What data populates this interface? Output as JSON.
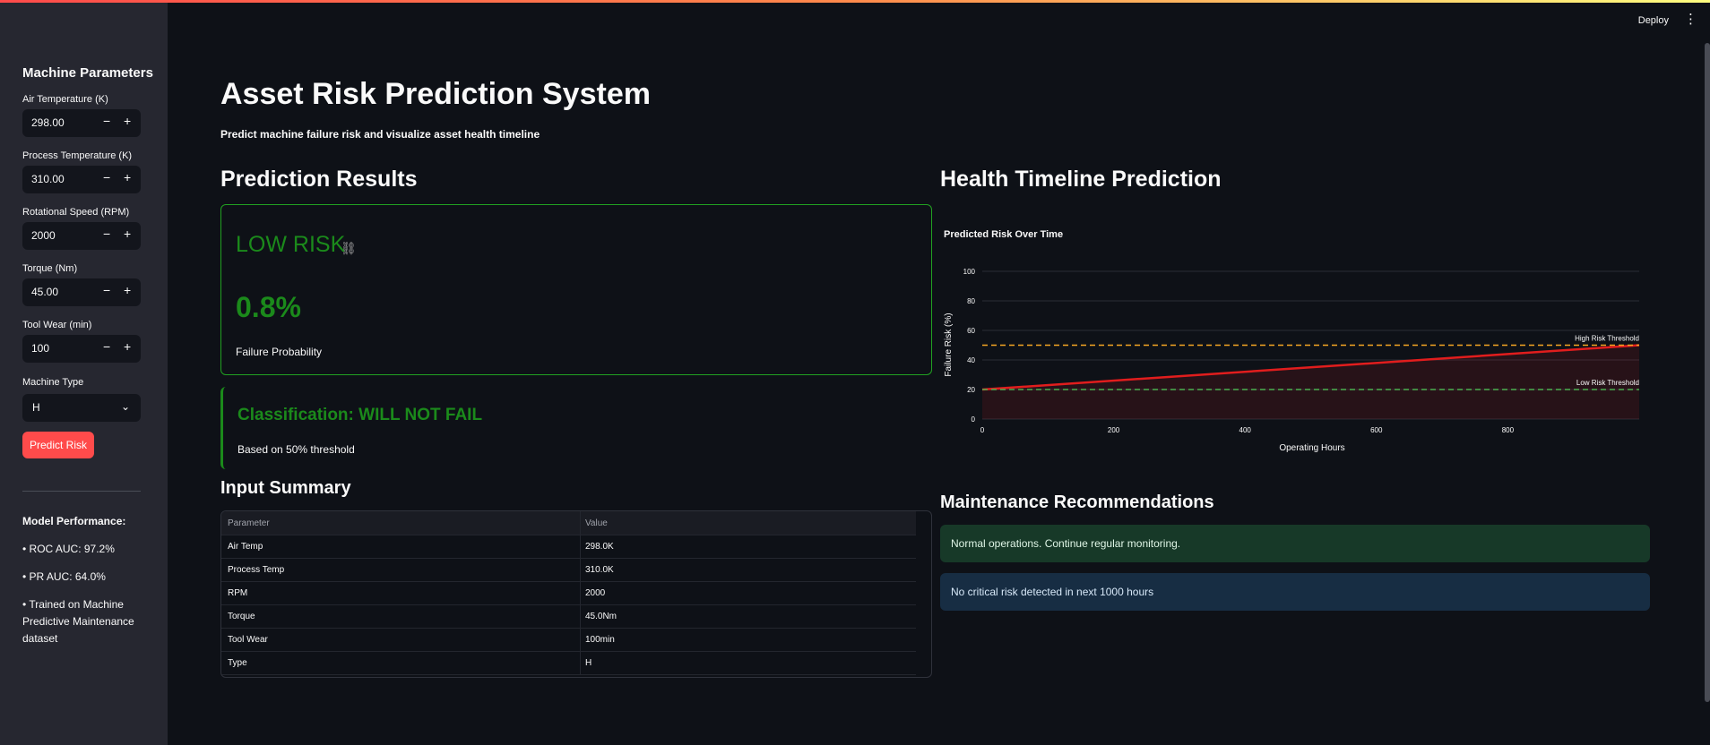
{
  "app": {
    "deploy_label": "Deploy",
    "menu_icon": "kebab-menu-icon"
  },
  "sidebar": {
    "title": "Machine Parameters",
    "inputs": [
      {
        "label": "Air Temperature (K)",
        "value": "298.00"
      },
      {
        "label": "Process Temperature (K)",
        "value": "310.00"
      },
      {
        "label": "Rotational Speed (RPM)",
        "value": "2000"
      },
      {
        "label": "Torque (Nm)",
        "value": "45.00"
      },
      {
        "label": "Tool Wear (min)",
        "value": "100"
      }
    ],
    "stepper_minus": "−",
    "stepper_plus": "+",
    "machine_type": {
      "label": "Machine Type",
      "value": "H"
    },
    "predict_button": "Predict Risk",
    "performance_title": "Model Performance:",
    "performance_items": [
      "• ROC AUC: 97.2%",
      "• PR AUC: 64.0%",
      "• Trained on Machine Predictive Maintenance dataset"
    ]
  },
  "main": {
    "title": "Asset Risk Prediction System",
    "subtitle": "Predict machine failure risk and visualize asset health timeline",
    "prediction": {
      "heading": "Prediction Results",
      "risk_level": "LOW RISK",
      "probability": "0.8%",
      "probability_caption": "Failure Probability",
      "classification": "Classification: WILL NOT FAIL",
      "basis": "Based on 50% threshold",
      "color": "#1b8a1b"
    },
    "summary": {
      "heading": "Input Summary",
      "columns": [
        "Parameter",
        "Value"
      ],
      "rows": [
        [
          "Air Temp",
          "298.0K"
        ],
        [
          "Process Temp",
          "310.0K"
        ],
        [
          "RPM",
          "2000"
        ],
        [
          "Torque",
          "45.0Nm"
        ],
        [
          "Tool Wear",
          "100min"
        ],
        [
          "Type",
          "H"
        ]
      ]
    },
    "timeline": {
      "heading": "Health Timeline Prediction"
    },
    "maintenance": {
      "heading": "Maintenance Recommendations",
      "success": "Normal operations. Continue regular monitoring.",
      "info": "No critical risk detected in next 1000 hours"
    }
  },
  "chart_data": {
    "type": "line",
    "title": "Predicted Risk Over Time",
    "xlabel": "Operating Hours",
    "ylabel": "Failure Risk (%)",
    "xlim": [
      0,
      1000
    ],
    "ylim": [
      0,
      100
    ],
    "xticks": [
      0,
      200,
      400,
      600,
      800
    ],
    "yticks": [
      0,
      20,
      40,
      60,
      80,
      100
    ],
    "series": [
      {
        "x": [
          0,
          1000
        ],
        "y": [
          20,
          50
        ],
        "color": "#e11d1d"
      }
    ],
    "thresholds": [
      {
        "label": "High Risk Threshold",
        "value": 50,
        "color": "#f5a623"
      },
      {
        "label": "Low Risk Threshold",
        "value": 20,
        "color": "#4caf50"
      }
    ],
    "grid": true
  }
}
